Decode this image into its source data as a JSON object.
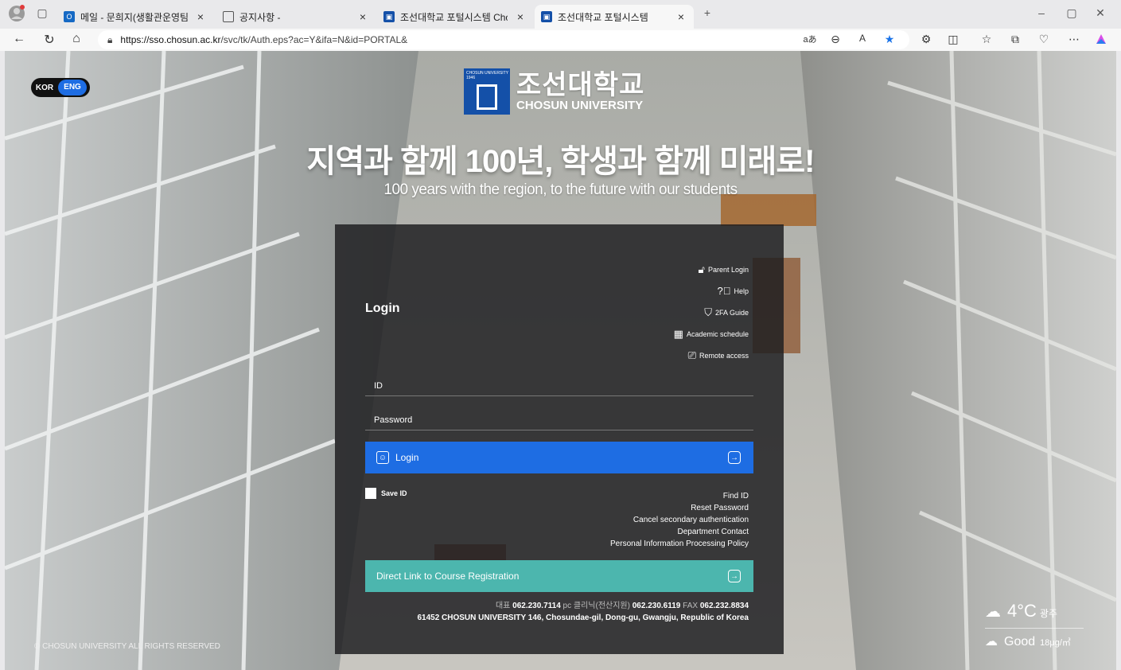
{
  "browser": {
    "tabs": [
      {
        "label": "메일 - 문희지(생활관운영팀) - Ou",
        "icon": "outlook-icon",
        "active": false
      },
      {
        "label": "공지사항 -",
        "icon": "page-icon",
        "active": false
      },
      {
        "label": "조선대학교 포털시스템 Chosun U",
        "icon": "chosun-favicon",
        "active": false
      },
      {
        "label": "조선대학교 포털시스템",
        "icon": "chosun-favicon",
        "active": true
      }
    ],
    "url_host": "https://sso.chosun.ac.kr",
    "url_path": "/svc/tk/Auth.eps?ac=Y&ifa=N&id=PORTAL&",
    "read_aloud": "aあ",
    "new_tab": "+"
  },
  "lang": {
    "kor": "KOR",
    "eng": "ENG"
  },
  "logo": {
    "ko": "조선대학교",
    "en": "CHOSUN UNIVERSITY",
    "emblem_text": "CHOSUN UNIVERSITY 1946"
  },
  "slogan": "지역과 함께 100년, 학생과 함께 미래로!",
  "subslogan": "100 years with the region, to the future with our students",
  "login": {
    "title": "Login",
    "quick_links": [
      "Parent Login",
      "Help",
      "2FA Guide",
      "Academic schedule",
      "Remote access"
    ],
    "id_placeholder": "ID",
    "password_placeholder": "Password",
    "login_button": "Login",
    "save_id": "Save ID",
    "links": [
      "Find ID",
      "Reset Password",
      "Cancel secondary authentication",
      "Department Contact",
      "Personal Information Processing Policy"
    ],
    "direct_link": "Direct Link to Course Registration",
    "contact": {
      "main_label": "대표",
      "main_phone": "062.230.7114",
      "pc_label": "pc 클리닉(전산지원)",
      "pc_phone": "062.230.6119",
      "fax_label": "FAX",
      "fax": "062.232.8834",
      "address": "61452 CHOSUN UNIVERSITY 146, Chosundae-gil, Dong-gu, Gwangju, Republic of Korea"
    }
  },
  "footer": {
    "copyright": "© CHOSUN UNIVERSITY ALL RIGHTS RESERVED"
  },
  "weather": {
    "temp": "4°C",
    "city": "광주",
    "air_quality": "Good",
    "pm": "18μg/㎥"
  },
  "colors": {
    "primary": "#1e6de3",
    "teal": "#4cb6ae",
    "panel": "#1e1e20",
    "logo_blue": "#1450a8"
  }
}
